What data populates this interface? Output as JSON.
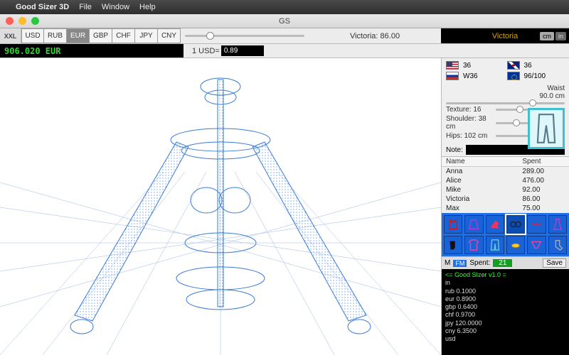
{
  "menubar": {
    "app": "Good Sizer 3D",
    "items": [
      "File",
      "Window",
      "Help"
    ]
  },
  "window": {
    "title": "GS"
  },
  "currencies": [
    "USD",
    "RUB",
    "EUR",
    "GBP",
    "CHF",
    "JPY",
    "CNY"
  ],
  "active_currency_index": 2,
  "profile_name": "Victoria",
  "units": {
    "metric": "cm",
    "imperial": "in",
    "active": "cm"
  },
  "total": "906.020 EUR",
  "rate": {
    "label": "1 USD=",
    "value": "0.89"
  },
  "status": "Victoria: 86.00",
  "sizes": {
    "us": "36",
    "ru": "W36",
    "uk": "36",
    "eu": "96/100"
  },
  "measure": {
    "waist_label": "Waist",
    "waist_value": "90.0 cm",
    "texture_label": "Texture:",
    "texture_value": "16",
    "shoulder_label": "Shoulder:",
    "shoulder_value": "38 cm",
    "hips_label": "Hips:",
    "hips_value": "102 cm"
  },
  "note_label": "Note:",
  "people": {
    "columns": [
      "Name",
      "Spent"
    ],
    "rows": [
      {
        "name": "Anna",
        "spent": "289.00"
      },
      {
        "name": "Alice",
        "spent": "476.00"
      },
      {
        "name": "Mike",
        "spent": "92.00"
      },
      {
        "name": "Victoria",
        "spent": "86.00"
      },
      {
        "name": "Max",
        "spent": "75.00"
      }
    ]
  },
  "items": [
    "tank",
    "skirt",
    "heel",
    "glasses",
    "bra",
    "dress",
    "glove",
    "t-shirt",
    "pants",
    "ring",
    "briefs",
    "socks"
  ],
  "selected_item_index": 3,
  "spentbar": {
    "m": "M",
    "fm": "FM",
    "label": "Spent:",
    "value": "21",
    "save": "Save"
  },
  "console": {
    "header": "<= Good SIzer v1.0  =",
    "lines": [
      "in",
      "rub 0.1000",
      "eur 0.8900",
      "gbp 0.6400",
      "chf 0.9700",
      "jpy 120.0000",
      "cny 6.3500",
      "usd"
    ]
  }
}
